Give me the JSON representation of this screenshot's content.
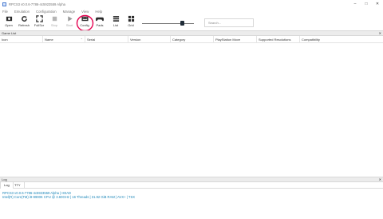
{
  "window": {
    "title": "RPCS3 v0.0.6-7786-4c5923559 Alpha",
    "minimize_glyph": "–",
    "maximize_glyph": "□",
    "close_glyph": "✕"
  },
  "menu": [
    "File",
    "Emulation",
    "Configuration",
    "Manage",
    "View",
    "Help"
  ],
  "toolbar": {
    "items": [
      {
        "label": "Open",
        "icon": "folder-icon",
        "enabled": true
      },
      {
        "label": "Refresh",
        "icon": "refresh-icon",
        "enabled": true
      },
      {
        "label": "FullScr",
        "icon": "fullscreen-icon",
        "enabled": true
      },
      {
        "label": "Stop",
        "icon": "stop-icon",
        "enabled": false
      },
      {
        "label": "Start",
        "icon": "play-icon",
        "enabled": false
      },
      {
        "label": "Config",
        "icon": "config-icon",
        "enabled": true
      },
      {
        "label": "Pads",
        "icon": "gamepad-icon",
        "enabled": true
      },
      {
        "label": "List",
        "icon": "list-icon",
        "enabled": true
      },
      {
        "label": "Grid",
        "icon": "grid-icon",
        "enabled": true
      }
    ],
    "icon_size_slider_value": 0.8,
    "search_placeholder": "Search..."
  },
  "game_list": {
    "title": "Game List",
    "close_glyph": "✕",
    "columns": [
      "Icon",
      "Name",
      "Serial",
      "Version",
      "Category",
      "PlayStation Move",
      "Supported Resolutions",
      "Compatibility"
    ],
    "sort_arrow": "⌃"
  },
  "log_panel": {
    "title": "Log",
    "close_glyph": "✕",
    "tabs": [
      "Log",
      "TTY"
    ],
    "lines": [
      "RPCS3 v0.0.6-7786-4c5923559 Alpha | HEAD",
      "Intel(R) Core(TM) i9-9900K CPU @ 3.60GHz | 16 Threads | 31.92 GiB RAM | AVX+ | TSX"
    ]
  },
  "colors": {
    "accent": "#1b86b9",
    "config_highlight": "#e5004f"
  }
}
